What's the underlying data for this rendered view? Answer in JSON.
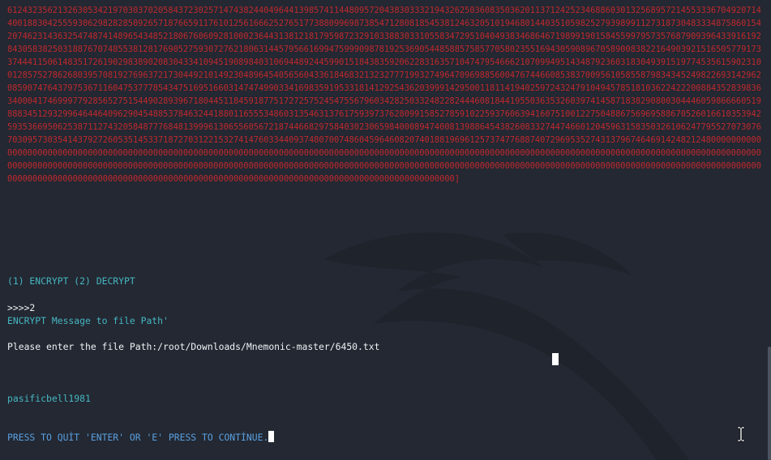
{
  "terminal": {
    "number_output": "61243235621326305342197030370205843723025714743824404964413985741144809572043830333219432625036083503620113712425234688603013256895721455333670492071440018830425559306298282850926571876659117610125616662527651773880996987385471280818545381246320510194680144035105982527939899112731873048333487586015420746231436325474874148965434852180676060928100023644313812181795987232910338830331055834729510404938346864671989919015845599795735768790939643391619284305838250318876707485538128176905275930727621806314457956616994759990987819253690544858857585770580235516943059089670589008382216490392151650577917337444115061483517261902983890208304334109451908984031069448924459901518438359206228316357104747954666210709949514348792360318304939151977453561590231001285752786268039570819276963721730449210149230489645405656043361846832132327771993274964709698856004767446608538370095610585587983434524982269314296208590747643797536711604753777854347516951660314747499033416983591953318141292543620399914295001181141940259724324791049457851810362242220088435283983634000417469997792856527515449028939671804451184591877517272575245475567960342825033248228244460818441955036353260397414587183829080030444605986666051988834512932996464464096290454885378463244188011655534860313546313761759397376280991585278591022593760639416075100122750488675696958867052601661035394259353669506253871127432058487776848139996130655605672187446682975840302306598400089474008139886454382608332744746601204596315835032610624779552707307670309573035414379272605351453371872703122153274147603344093748070074860459646082074018819696125737477688740729695352743137967464691424821248000000000000000000000000000000000000000000000000000000000000000000000000000000000000000000000000000000000000000000000000000000000000000000000000000000000000000000000000000000000000000000000000000000000000000000000000000000000000000000000000000000000000000000000000000000000000000000000000000000000000000000000000000000000000000000000000000000000000000000000000000000000000000000000000000000000000000]",
    "menu_line": "(1) ENCRYPT (2) DECRYPT",
    "input_prompt": ">>>>2",
    "encrypt_line": "ENCRYPT Message to file Path'",
    "file_prompt": "Please enter the file Path:/root/Downloads/Mnemonic-master/6450.txt",
    "result_text": "pasificbell1981",
    "quit_prompt": "PRESS TO QUİT 'ENTER' OR 'E' PRESS TO CONTİNUE."
  },
  "colors": {
    "background": "#232832",
    "digits": "#c0282e",
    "cyan_text": "#46b6c2",
    "white_text": "#eef2f5",
    "blue_text": "#5a9fe0"
  },
  "icons": {
    "watermark": "kali-dragon-watermark",
    "pointer": "text-ibeam-cursor"
  }
}
